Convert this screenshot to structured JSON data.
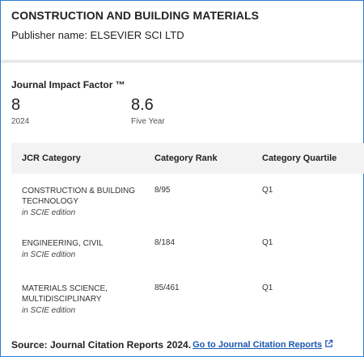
{
  "journal": {
    "title": "CONSTRUCTION AND BUILDING MATERIALS",
    "publisher": "Publisher name: ELSEVIER SCI LTD"
  },
  "jif": {
    "title": "Journal Impact Factor ™",
    "metrics": [
      {
        "value": "8",
        "label": "2024"
      },
      {
        "value": "8.6",
        "label": "Five Year"
      }
    ]
  },
  "table": {
    "headers": [
      "JCR Category",
      "Category Rank",
      "Category Quartile"
    ],
    "rows": [
      {
        "category": "CONSTRUCTION & BUILDING TECHNOLOGY",
        "edition": "in SCIE edition",
        "rank": "8/95",
        "quartile": "Q1"
      },
      {
        "category": "ENGINEERING, CIVIL",
        "edition": "in SCIE edition",
        "rank": "8/184",
        "quartile": "Q1"
      },
      {
        "category": "MATERIALS SCIENCE, MULTIDISCIPLINARY",
        "edition": "in SCIE edition",
        "rank": "85/461",
        "quartile": "Q1"
      }
    ]
  },
  "footer": {
    "source": "Source: Journal Citation Reports",
    "year": "2024.",
    "link": "Go to Journal Citation Reports",
    "link_icon": "external-link-icon",
    "link_color": "#1a57b0"
  },
  "colors": {
    "border": "#2e7bd0",
    "header_bg": "#f3f3f3"
  }
}
